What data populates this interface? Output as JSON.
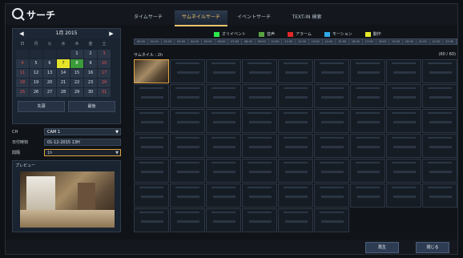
{
  "title": "サーチ",
  "tabs": [
    {
      "label": "タイムサーチ"
    },
    {
      "label": "サムネイルサーチ"
    },
    {
      "label": "イベントサーチ"
    },
    {
      "label": "TEXT-IN 検索"
    }
  ],
  "calendar": {
    "month": "1月 2015",
    "weekdays": [
      "日",
      "月",
      "火",
      "水",
      "木",
      "金",
      "土"
    ],
    "cells": [
      [
        "",
        "",
        "",
        "",
        "1",
        "2",
        "3"
      ],
      [
        "4",
        "5",
        "6",
        "7",
        "8",
        "9",
        "10"
      ],
      [
        "11",
        "12",
        "13",
        "14",
        "15",
        "16",
        "17"
      ],
      [
        "18",
        "19",
        "20",
        "21",
        "22",
        "23",
        "24"
      ],
      [
        "25",
        "26",
        "27",
        "28",
        "29",
        "30",
        "31"
      ]
    ],
    "btn_first": "先頭",
    "btn_last": "最後"
  },
  "fields": {
    "ch_label": "CH",
    "ch_value": "CAM 1",
    "datetime_label": "日付時刻",
    "datetime_value": "01-12-2015 13H",
    "interval_label": "間隔",
    "interval_value": "1h"
  },
  "preview_label": "プレビュー",
  "legend": [
    {
      "label": "オリイベント",
      "color": "#2ee74c"
    },
    {
      "label": "音声",
      "color": "#5aa342"
    },
    {
      "label": "アラーム",
      "color": "#e02828"
    },
    {
      "label": "モーション",
      "color": "#2ea9ea"
    },
    {
      "label": "動作",
      "color": "#e6e92b"
    }
  ],
  "time_ticks": [
    "00:00",
    "01:00",
    "02:00",
    "03:00",
    "04:00",
    "05:00",
    "06:00",
    "07:00",
    "08:00",
    "09:00",
    "10:00",
    "11:00",
    "12:00",
    "13:00",
    "14:00",
    "15:00",
    "16:00",
    "17:00",
    "18:00",
    "19:00",
    "20:00",
    "21:00",
    "22:00",
    "23:00"
  ],
  "thumbnails_label": "サムネイル : 2h",
  "thumbnails_count": "(60 / 60)",
  "buttons": {
    "play": "再生",
    "close": "閉じる"
  }
}
